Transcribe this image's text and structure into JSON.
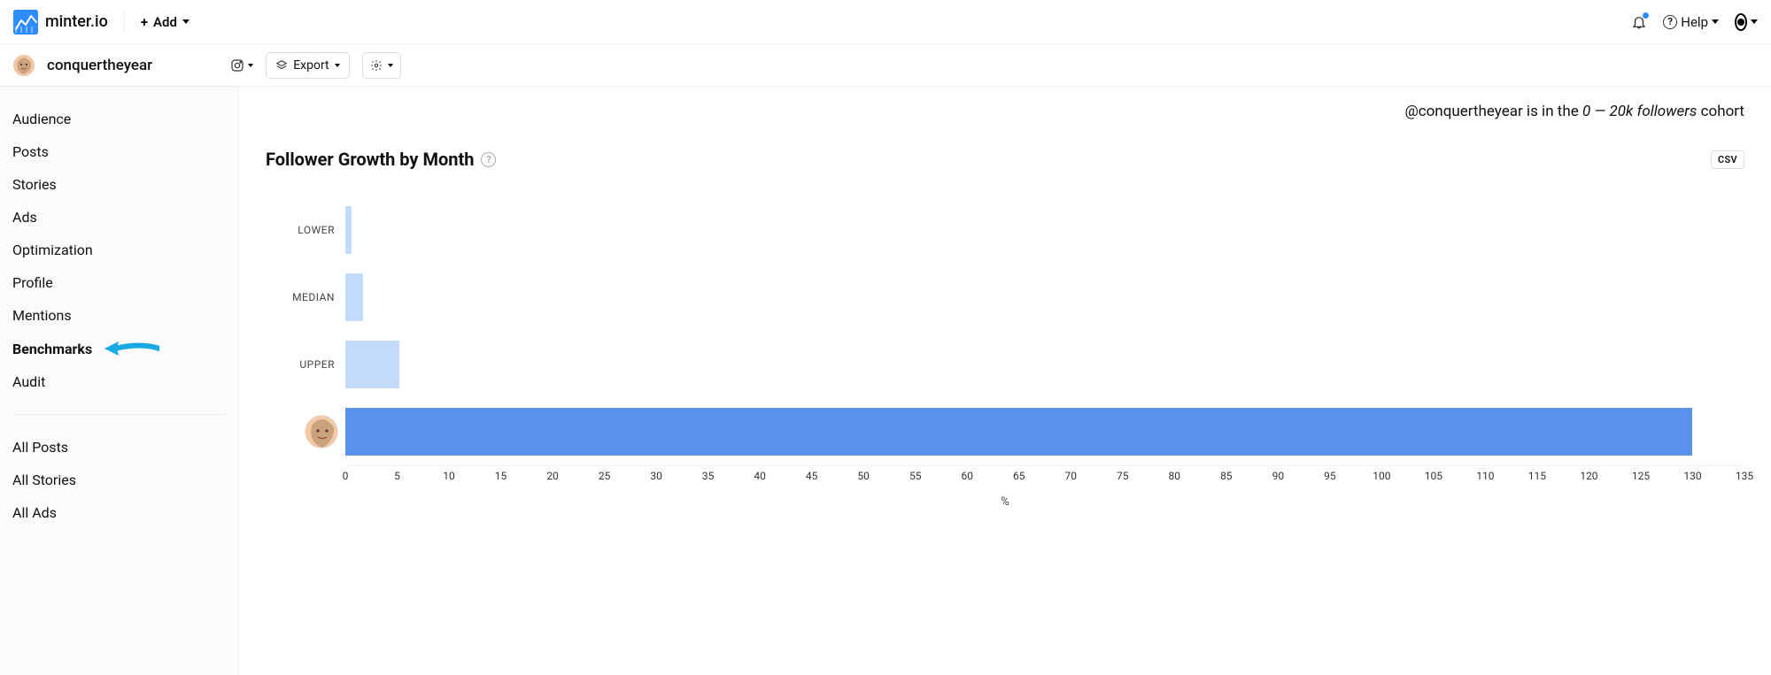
{
  "header": {
    "brand": "minter.io",
    "add_label": "Add",
    "help_label": "Help"
  },
  "subheader": {
    "profile_name": "conquertheyear",
    "export_label": "Export"
  },
  "sidebar": {
    "items": [
      {
        "label": "Audience",
        "active": false
      },
      {
        "label": "Posts",
        "active": false
      },
      {
        "label": "Stories",
        "active": false
      },
      {
        "label": "Ads",
        "active": false
      },
      {
        "label": "Optimization",
        "active": false
      },
      {
        "label": "Profile",
        "active": false
      },
      {
        "label": "Mentions",
        "active": false
      },
      {
        "label": "Benchmarks",
        "active": true
      },
      {
        "label": "Audit",
        "active": false
      }
    ],
    "items2": [
      {
        "label": "All Posts"
      },
      {
        "label": "All Stories"
      },
      {
        "label": "All Ads"
      }
    ]
  },
  "cohort": {
    "pre": "@conquertheyear is in the ",
    "range": "0 — 20k followers",
    "post": " cohort"
  },
  "section": {
    "title": "Follower Growth by Month",
    "csv": "CSV"
  },
  "chart_data": {
    "type": "bar",
    "orientation": "horizontal",
    "categories": [
      "LOWER",
      "MEDIAN",
      "UPPER",
      "@conquertheyear"
    ],
    "values": [
      0.6,
      1.7,
      5.2,
      130
    ],
    "colors": [
      "#c4dcfb",
      "#c4dcfb",
      "#c4dcfb",
      "#5b93ec"
    ],
    "xlabel": "%",
    "xlim": [
      0,
      135
    ],
    "xticks": [
      0,
      5,
      10,
      15,
      20,
      25,
      30,
      35,
      40,
      45,
      50,
      55,
      60,
      65,
      70,
      75,
      80,
      85,
      90,
      95,
      100,
      105,
      110,
      115,
      120,
      125,
      130,
      135
    ],
    "title": "Follower Growth by Month"
  }
}
